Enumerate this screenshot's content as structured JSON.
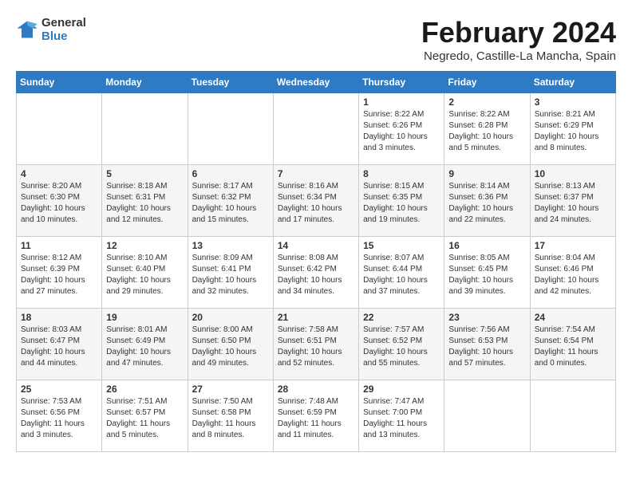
{
  "header": {
    "logo_line1": "General",
    "logo_line2": "Blue",
    "main_title": "February 2024",
    "subtitle": "Negredo, Castille-La Mancha, Spain"
  },
  "calendar": {
    "days_of_week": [
      "Sunday",
      "Monday",
      "Tuesday",
      "Wednesday",
      "Thursday",
      "Friday",
      "Saturday"
    ],
    "weeks": [
      [
        {
          "day": "",
          "info": ""
        },
        {
          "day": "",
          "info": ""
        },
        {
          "day": "",
          "info": ""
        },
        {
          "day": "",
          "info": ""
        },
        {
          "day": "1",
          "info": "Sunrise: 8:22 AM\nSunset: 6:26 PM\nDaylight: 10 hours\nand 3 minutes."
        },
        {
          "day": "2",
          "info": "Sunrise: 8:22 AM\nSunset: 6:28 PM\nDaylight: 10 hours\nand 5 minutes."
        },
        {
          "day": "3",
          "info": "Sunrise: 8:21 AM\nSunset: 6:29 PM\nDaylight: 10 hours\nand 8 minutes."
        }
      ],
      [
        {
          "day": "4",
          "info": "Sunrise: 8:20 AM\nSunset: 6:30 PM\nDaylight: 10 hours\nand 10 minutes."
        },
        {
          "day": "5",
          "info": "Sunrise: 8:18 AM\nSunset: 6:31 PM\nDaylight: 10 hours\nand 12 minutes."
        },
        {
          "day": "6",
          "info": "Sunrise: 8:17 AM\nSunset: 6:32 PM\nDaylight: 10 hours\nand 15 minutes."
        },
        {
          "day": "7",
          "info": "Sunrise: 8:16 AM\nSunset: 6:34 PM\nDaylight: 10 hours\nand 17 minutes."
        },
        {
          "day": "8",
          "info": "Sunrise: 8:15 AM\nSunset: 6:35 PM\nDaylight: 10 hours\nand 19 minutes."
        },
        {
          "day": "9",
          "info": "Sunrise: 8:14 AM\nSunset: 6:36 PM\nDaylight: 10 hours\nand 22 minutes."
        },
        {
          "day": "10",
          "info": "Sunrise: 8:13 AM\nSunset: 6:37 PM\nDaylight: 10 hours\nand 24 minutes."
        }
      ],
      [
        {
          "day": "11",
          "info": "Sunrise: 8:12 AM\nSunset: 6:39 PM\nDaylight: 10 hours\nand 27 minutes."
        },
        {
          "day": "12",
          "info": "Sunrise: 8:10 AM\nSunset: 6:40 PM\nDaylight: 10 hours\nand 29 minutes."
        },
        {
          "day": "13",
          "info": "Sunrise: 8:09 AM\nSunset: 6:41 PM\nDaylight: 10 hours\nand 32 minutes."
        },
        {
          "day": "14",
          "info": "Sunrise: 8:08 AM\nSunset: 6:42 PM\nDaylight: 10 hours\nand 34 minutes."
        },
        {
          "day": "15",
          "info": "Sunrise: 8:07 AM\nSunset: 6:44 PM\nDaylight: 10 hours\nand 37 minutes."
        },
        {
          "day": "16",
          "info": "Sunrise: 8:05 AM\nSunset: 6:45 PM\nDaylight: 10 hours\nand 39 minutes."
        },
        {
          "day": "17",
          "info": "Sunrise: 8:04 AM\nSunset: 6:46 PM\nDaylight: 10 hours\nand 42 minutes."
        }
      ],
      [
        {
          "day": "18",
          "info": "Sunrise: 8:03 AM\nSunset: 6:47 PM\nDaylight: 10 hours\nand 44 minutes."
        },
        {
          "day": "19",
          "info": "Sunrise: 8:01 AM\nSunset: 6:49 PM\nDaylight: 10 hours\nand 47 minutes."
        },
        {
          "day": "20",
          "info": "Sunrise: 8:00 AM\nSunset: 6:50 PM\nDaylight: 10 hours\nand 49 minutes."
        },
        {
          "day": "21",
          "info": "Sunrise: 7:58 AM\nSunset: 6:51 PM\nDaylight: 10 hours\nand 52 minutes."
        },
        {
          "day": "22",
          "info": "Sunrise: 7:57 AM\nSunset: 6:52 PM\nDaylight: 10 hours\nand 55 minutes."
        },
        {
          "day": "23",
          "info": "Sunrise: 7:56 AM\nSunset: 6:53 PM\nDaylight: 10 hours\nand 57 minutes."
        },
        {
          "day": "24",
          "info": "Sunrise: 7:54 AM\nSunset: 6:54 PM\nDaylight: 11 hours\nand 0 minutes."
        }
      ],
      [
        {
          "day": "25",
          "info": "Sunrise: 7:53 AM\nSunset: 6:56 PM\nDaylight: 11 hours\nand 3 minutes."
        },
        {
          "day": "26",
          "info": "Sunrise: 7:51 AM\nSunset: 6:57 PM\nDaylight: 11 hours\nand 5 minutes."
        },
        {
          "day": "27",
          "info": "Sunrise: 7:50 AM\nSunset: 6:58 PM\nDaylight: 11 hours\nand 8 minutes."
        },
        {
          "day": "28",
          "info": "Sunrise: 7:48 AM\nSunset: 6:59 PM\nDaylight: 11 hours\nand 11 minutes."
        },
        {
          "day": "29",
          "info": "Sunrise: 7:47 AM\nSunset: 7:00 PM\nDaylight: 11 hours\nand 13 minutes."
        },
        {
          "day": "",
          "info": ""
        },
        {
          "day": "",
          "info": ""
        }
      ]
    ]
  }
}
